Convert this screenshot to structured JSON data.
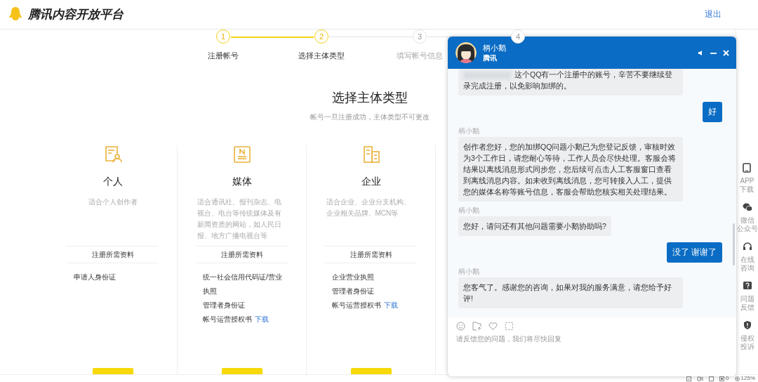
{
  "header": {
    "title": "腾讯内容开放平台",
    "logout": "退出"
  },
  "steps": [
    {
      "number": "1",
      "label": "注册帐号",
      "done": true
    },
    {
      "number": "2",
      "label": "选择主体类型",
      "done": true
    },
    {
      "number": "3",
      "label": "填写帐号信息",
      "done": false
    },
    {
      "number": "4",
      "done": false
    }
  ],
  "heading": {
    "title": "选择主体类型",
    "subtitle": "帐号一旦注册成功，主体类型不可更改"
  },
  "cards": [
    {
      "kind": "person",
      "name": "个人",
      "description": "适合个人创作者",
      "requirements_title": "注册所需资料",
      "requirements": [
        {
          "text": "申请人身份证"
        }
      ]
    },
    {
      "kind": "media",
      "name": "媒体",
      "description": "适合通讯社、报刊杂志、电视台、电台等传统媒体及有新闻资质的网站，如人民日报、地方广播电视台等",
      "requirements_title": "注册所需资料",
      "requirements": [
        {
          "text": "统一社会信用代码证/营业执照"
        },
        {
          "text": "管理者身份证"
        },
        {
          "text": "帐号运营授权书",
          "link": "下载"
        }
      ]
    },
    {
      "kind": "company",
      "name": "企业",
      "description": "适合企业、企业分支机构、企业相关品牌、MCN等",
      "requirements_title": "注册所需资料",
      "requirements": [
        {
          "text": "企业营业执照"
        },
        {
          "text": "管理者身份证"
        },
        {
          "text": "帐号运营授权书",
          "link": "下载"
        }
      ]
    }
  ],
  "sidebar": {
    "items": [
      {
        "kind": "tablet",
        "lines": [
          "APP",
          "下载"
        ]
      },
      {
        "kind": "wechat",
        "lines": [
          "微信",
          "公众号"
        ]
      },
      {
        "kind": "headset",
        "lines": [
          "在线",
          "咨询"
        ]
      },
      {
        "kind": "question",
        "lines": [
          "问题",
          "反馈"
        ]
      },
      {
        "kind": "shield",
        "lines": [
          "侵权",
          "投诉"
        ]
      }
    ]
  },
  "chat": {
    "agent_name": "柄小鹅",
    "agent_org": "腾讯",
    "messages": [
      {
        "kind": "agent",
        "redacted": true,
        "text": "这个QQ有一个注册中的账号，辛苦不要继续登录完成注册，以免影响加绑的。"
      },
      {
        "kind": "user",
        "text": "好"
      },
      {
        "kind": "agent",
        "sender": "柄小鹅",
        "text": "创作者您好，您的加绑QQ问题小鹅已为您登记反馈，审核时效为3个工作日，请您耐心等待，工作人员会尽快处理。客服会将结果以离线消息形式同步您，您后续可点击人工客服窗口查看到离线消息内容。如未收到离线消息，您可转接入人工，提供您的媒体名称等账号信息，客服会帮助您核实相关处理结果。"
      },
      {
        "kind": "agent",
        "sender": "柄小鹅",
        "text": "您好，请问还有其他问题需要小鹅协助吗?"
      },
      {
        "kind": "user",
        "text": "没了 谢谢了"
      },
      {
        "kind": "agent",
        "sender": "柄小鹅",
        "text": "您客气了。感谢您的咨询，如果对我的服务满意，请您给予好评!"
      }
    ],
    "input": {
      "placeholder": "请反馈您的问题，我们将尽快回复"
    }
  },
  "status_bar": {
    "count": "0",
    "zoom": "125%"
  }
}
